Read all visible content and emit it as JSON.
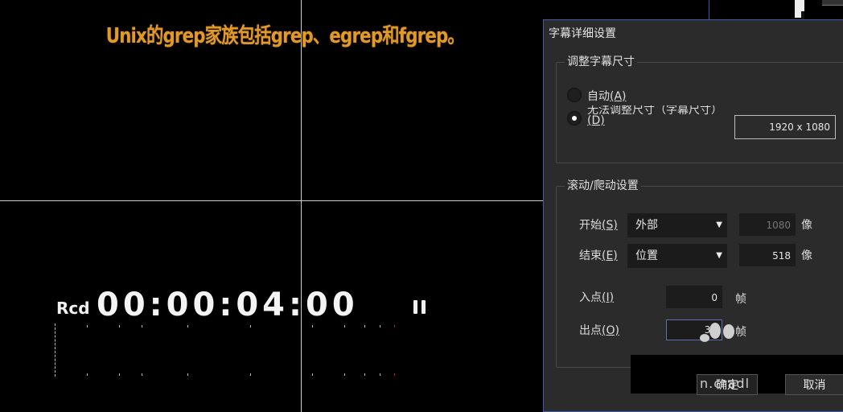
{
  "preview": {
    "caption": "Unix的grep家族包括grep、egrep和fgrep。",
    "timecode_label": "Rcd",
    "timecode": "00:00:04:00"
  },
  "dialog": {
    "title": "字幕详细设置",
    "size_group": {
      "title": "调整字幕尺寸",
      "auto_label": "自动",
      "auto_key": "(A)",
      "nosize_label": "无法调整尺寸（字幕尺寸）",
      "nosize_key": "(D)",
      "size_value": "1920 x 1080"
    },
    "scroll_group": {
      "title": "滚动/爬动设置",
      "start_label": "开始",
      "start_key": "(S)",
      "start_option": "外部",
      "start_value": "1080",
      "end_label": "结束",
      "end_key": "(E)",
      "end_option": "位置",
      "end_value": "518",
      "pixel_unit": "像",
      "in_label": "入点",
      "in_key": "(I)",
      "in_value": "0",
      "out_label": "出点",
      "out_key": "(O)",
      "out_value": "33",
      "frame_unit": "帧"
    },
    "ok_overlay_text": "n.cradl",
    "ok_label": "确定",
    "cancel_label": "取消"
  },
  "colors": {
    "caption": "#e09a2a",
    "dialog_bg": "#2b2b2b",
    "accent_border": "#3a5bb0"
  }
}
